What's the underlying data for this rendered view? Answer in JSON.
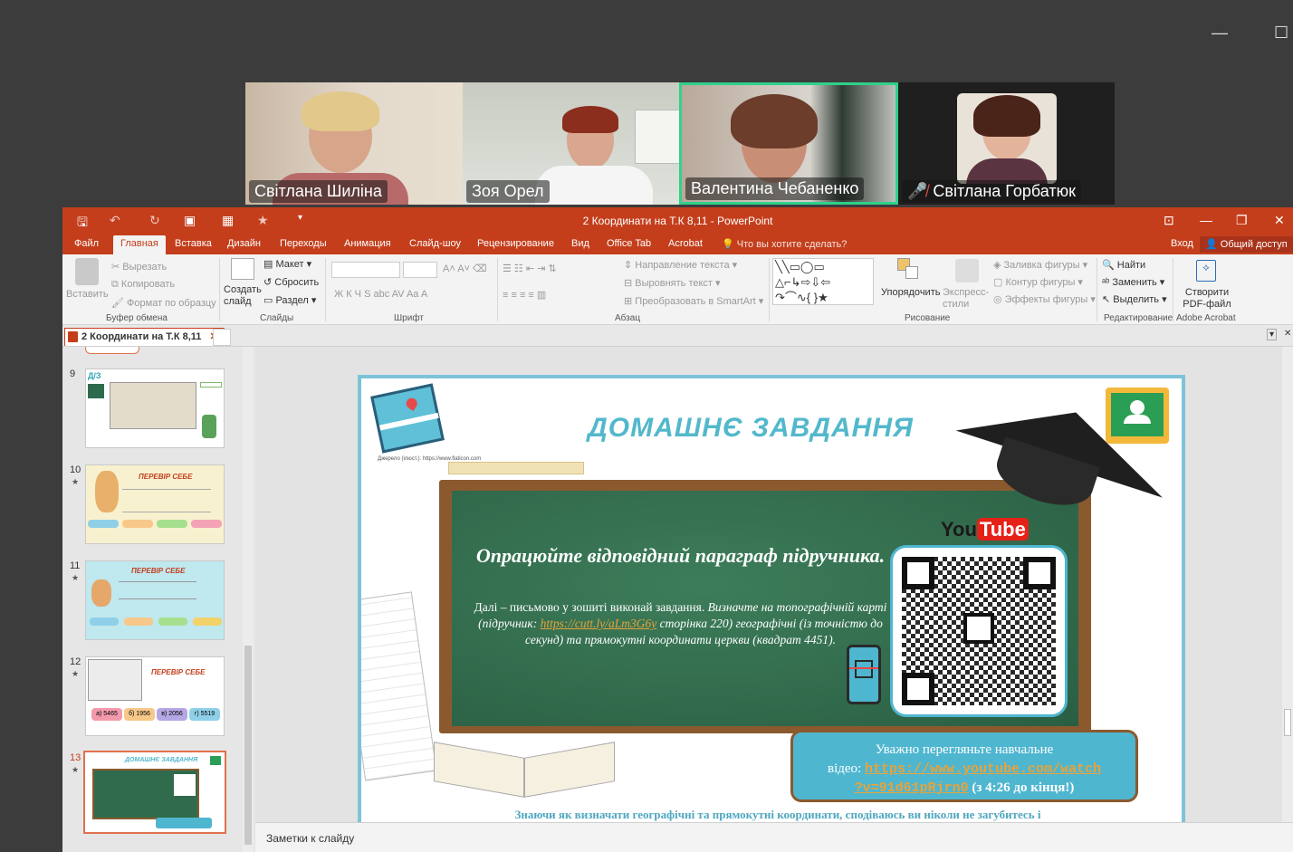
{
  "window_controls": {
    "minimize": "—",
    "maximize": "☐"
  },
  "participants": [
    {
      "name": "Світлана Шиліна",
      "muted": false,
      "active": false
    },
    {
      "name": "Зоя Орел",
      "muted": false,
      "active": false
    },
    {
      "name": "Валентина Чебаненко",
      "muted": false,
      "active": true
    },
    {
      "name": "Світлана Горбатюк",
      "muted": true,
      "active": false
    }
  ],
  "colors": {
    "ppt_accent": "#c43e1c",
    "active_speaker": "#2fd18b",
    "slide_border": "#7dc3d8"
  },
  "ppt": {
    "title": "2 Координати на Т.К 8,11  -  PowerPoint",
    "tabs": [
      "Файл",
      "Главная",
      "Вставка",
      "Дизайн",
      "Переходы",
      "Анимация",
      "Слайд-шоу",
      "Рецензирование",
      "Вид",
      "Office Tab",
      "Acrobat"
    ],
    "tell_me": "Что вы хотите сделать?",
    "signin": "Вход",
    "share": "Общий доступ",
    "ribbon": {
      "paste": "Вставить",
      "cut": "Вырезать",
      "copy": "Копировать",
      "format_painter": "Формат по образцу",
      "clipboard_group": "Буфер обмена",
      "new_slide": "Создать слайд",
      "layout": "Макет",
      "reset": "Сбросить",
      "section": "Раздел",
      "slides_group": "Слайды",
      "font_group": "Шрифт",
      "text_direction": "Направление текста",
      "align_text": "Выровнять текст",
      "smartart": "Преобразовать в SmartArt",
      "paragraph_group": "Абзац",
      "arrange": "Упорядочить",
      "quick_styles": "Экспресс-стили",
      "shape_fill": "Заливка фигуры",
      "shape_outline": "Контур фигуры",
      "shape_effects": "Эффекты фигуры",
      "drawing_group": "Рисование",
      "find": "Найти",
      "replace": "Заменить",
      "select": "Выделить",
      "editing_group": "Редактирование",
      "create_pdf": "Створити PDF-файл",
      "acrobat_group": "Adobe Acrobat"
    },
    "doc_tab": "2 Координати на Т.К 8,11",
    "notes_placeholder": "Заметки к слайду",
    "thumbnails": [
      {
        "num": "9",
        "star": ""
      },
      {
        "num": "10",
        "star": "★"
      },
      {
        "num": "11",
        "star": "★"
      },
      {
        "num": "12",
        "star": "★"
      },
      {
        "num": "13",
        "star": "★"
      }
    ],
    "thumb_texts": {
      "t10": "ПЕРЕВІР СЕБЕ",
      "t11": "ПЕРЕВІР СЕБЕ",
      "t12": "ПЕРЕВІР СЕБЕ",
      "t12_answers": [
        "а) 5465",
        "б) 1956",
        "в) 2056",
        "г) 5519"
      ],
      "t13": "ДОМАШНЄ ЗАВДАННЯ"
    }
  },
  "slide": {
    "title": "ДОМАШНЄ ЗАВДАННЯ",
    "map_caption": "Джерело (ілюст.): https://www.flaticon.com",
    "board_heading": "Опрацюйте відповідний параграф підручника.",
    "board_p1": "Далі – письмово у зошиті виконай завдання. ",
    "board_p2": "Визначте на топографічній карті (підручник: ",
    "board_link": "https://cutt.ly/aLm3G6y",
    "board_p3": " сторінка 220) географічні (із точністю до секунд) та прямокутні координати церкви (квадрат 4451).",
    "youtube": "YouTube",
    "video_line1": "Уважно перегляньте навчальне",
    "video_line2_prefix": "відео: ",
    "video_url_a": "https://www.youtube.com/watch",
    "video_url_b": "?v=91d61pRjrn0",
    "video_suffix": " (з 4:26 до кінця!)",
    "bottom": "Знаючи як визначати географічні та прямокутні координати, сподіваюсь ви ніколи не загубитесь і"
  }
}
